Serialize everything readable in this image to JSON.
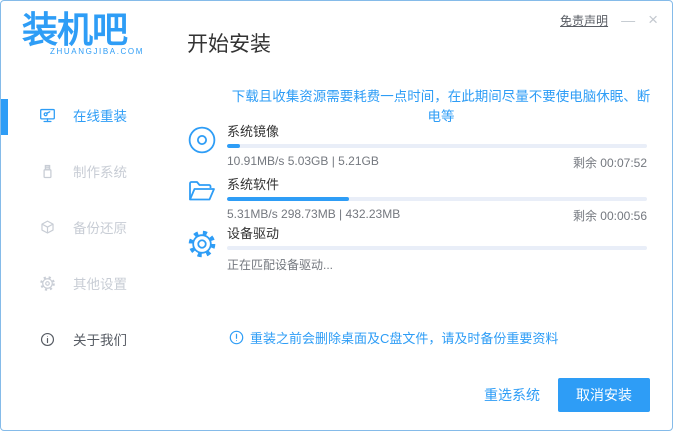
{
  "window": {
    "logo": "装机吧",
    "logo_sub": "ZHUANGJIBA.COM",
    "page_title": "开始安装",
    "disclaimer": "免责声明",
    "minimize_glyph": "—",
    "close_glyph": "×"
  },
  "sidebar": {
    "items": [
      {
        "label": "在线重装",
        "icon": "monitor-reinstall-icon",
        "active": true
      },
      {
        "label": "制作系统",
        "icon": "usb-drive-icon",
        "active": false
      },
      {
        "label": "备份还原",
        "icon": "backup-restore-icon",
        "active": false
      },
      {
        "label": "其他设置",
        "icon": "gear-icon",
        "active": false
      },
      {
        "label": "关于我们",
        "icon": "info-icon",
        "active": false
      }
    ]
  },
  "main": {
    "notice": "下载且收集资源需要耗费一点时间，在此期间尽量不要使电脑休眠、断电等",
    "tasks": [
      {
        "name": "系统镜像",
        "icon": "disc-icon",
        "progress_percent": 3,
        "stats": "10.91MB/s 5.03GB | 5.21GB",
        "remaining": "剩余 00:07:52"
      },
      {
        "name": "系统软件",
        "icon": "folder-icon",
        "progress_percent": 29,
        "stats": "5.31MB/s 298.73MB | 432.23MB",
        "remaining": "剩余 00:00:56"
      },
      {
        "name": "设备驱动",
        "icon": "gear-icon",
        "progress_percent": 0,
        "status": "正在匹配设备驱动..."
      }
    ],
    "warning": "重装之前会删除桌面及C盘文件，请及时备份重要资料",
    "footer": {
      "reselect_label": "重选系统",
      "cancel_label": "取消安装"
    }
  },
  "colors": {
    "accent": "#2e9df6",
    "disabled_text": "#c8cdd5",
    "track": "#e9eef8",
    "border": "#85bbe9"
  }
}
